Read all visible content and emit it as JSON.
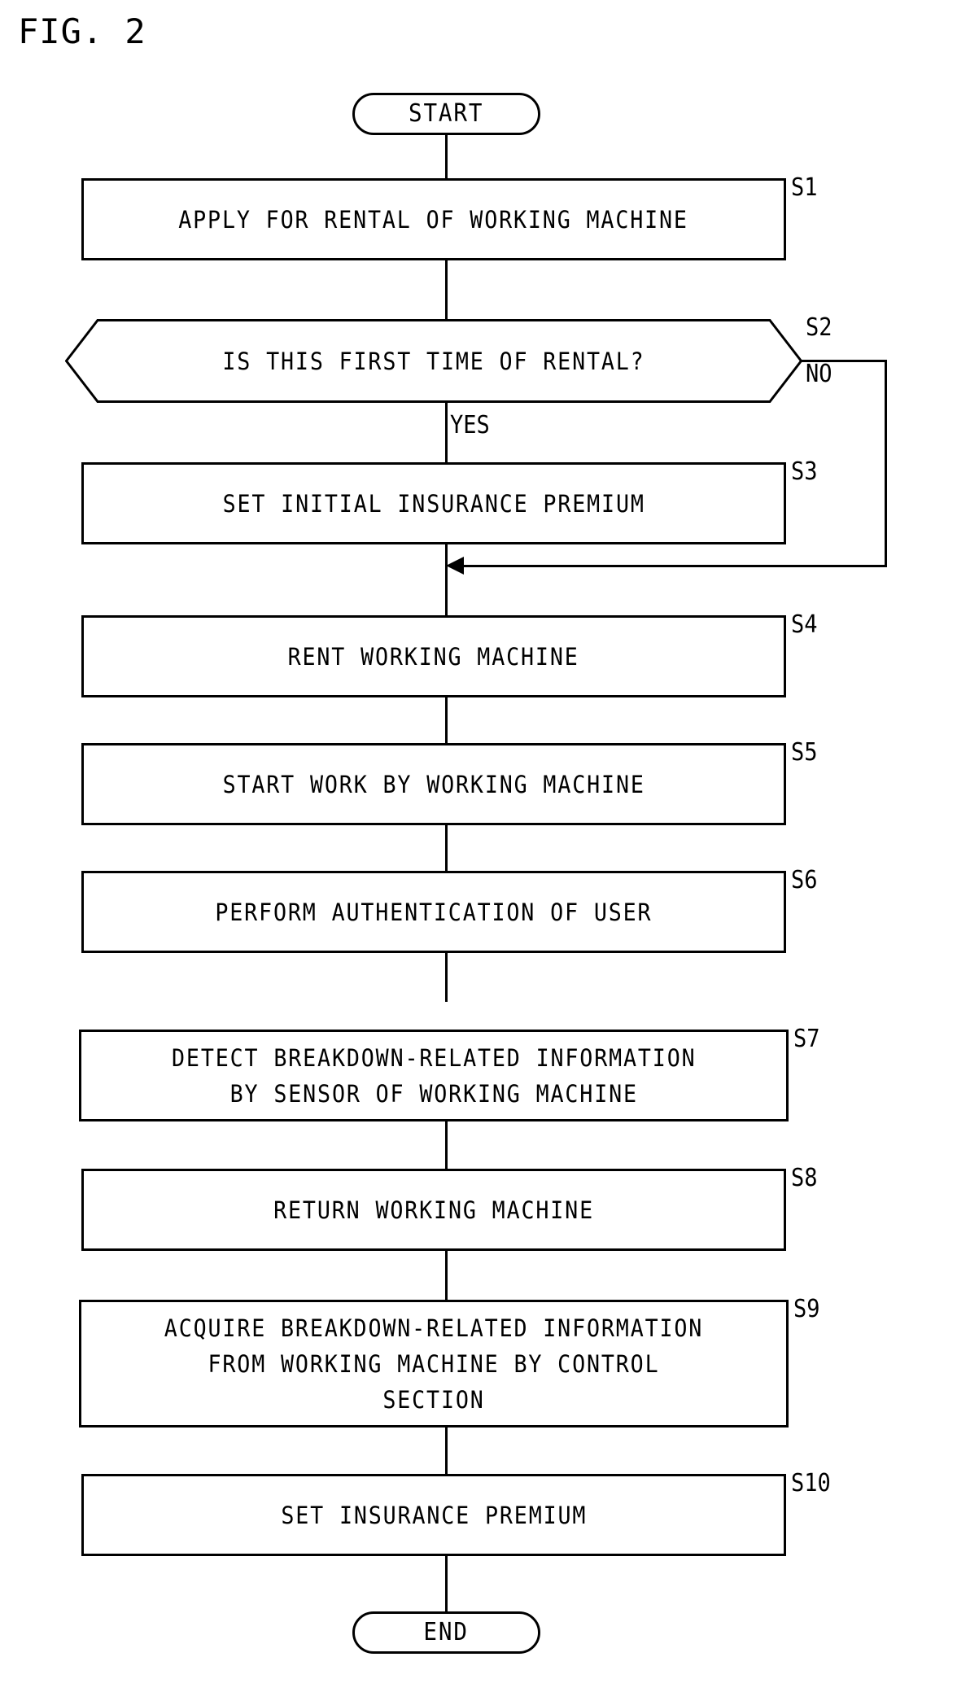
{
  "figure": {
    "title": "FIG. 2"
  },
  "flowchart": {
    "type": "flowchart",
    "orientation": "vertical",
    "start": {
      "label": "START"
    },
    "end": {
      "label": "END"
    },
    "branch_labels": {
      "yes": "YES",
      "no": "NO"
    },
    "steps": [
      {
        "id": "S1",
        "shape": "process",
        "text": "APPLY FOR RENTAL OF WORKING MACHINE"
      },
      {
        "id": "S2",
        "shape": "decision",
        "text": "IS THIS FIRST TIME OF RENTAL?"
      },
      {
        "id": "S3",
        "shape": "process",
        "text": "SET INITIAL INSURANCE PREMIUM"
      },
      {
        "id": "S4",
        "shape": "process",
        "text": "RENT WORKING MACHINE"
      },
      {
        "id": "S5",
        "shape": "process",
        "text": "START WORK BY WORKING MACHINE"
      },
      {
        "id": "S6",
        "shape": "process",
        "text": "PERFORM AUTHENTICATION OF USER"
      },
      {
        "id": "S7",
        "shape": "process",
        "text": "DETECT BREAKDOWN-RELATED INFORMATION\nBY SENSOR OF WORKING MACHINE"
      },
      {
        "id": "S8",
        "shape": "process",
        "text": "RETURN WORKING MACHINE"
      },
      {
        "id": "S9",
        "shape": "process",
        "text": "ACQUIRE BREAKDOWN-RELATED INFORMATION\nFROM WORKING MACHINE BY CONTROL\nSECTION"
      },
      {
        "id": "S10",
        "shape": "process",
        "text": "SET INSURANCE PREMIUM"
      }
    ],
    "edges": [
      {
        "from": "START",
        "to": "S1"
      },
      {
        "from": "S1",
        "to": "S2"
      },
      {
        "from": "S2",
        "to": "S3",
        "label": "YES"
      },
      {
        "from": "S2",
        "to": "S4",
        "label": "NO"
      },
      {
        "from": "S3",
        "to": "S4"
      },
      {
        "from": "S4",
        "to": "S5"
      },
      {
        "from": "S5",
        "to": "S6"
      },
      {
        "from": "S6",
        "to": "S7"
      },
      {
        "from": "S7",
        "to": "S8"
      },
      {
        "from": "S8",
        "to": "S9"
      },
      {
        "from": "S9",
        "to": "S10"
      },
      {
        "from": "S10",
        "to": "END"
      }
    ]
  },
  "colors": {
    "ink": "#000000",
    "paper": "#ffffff"
  }
}
